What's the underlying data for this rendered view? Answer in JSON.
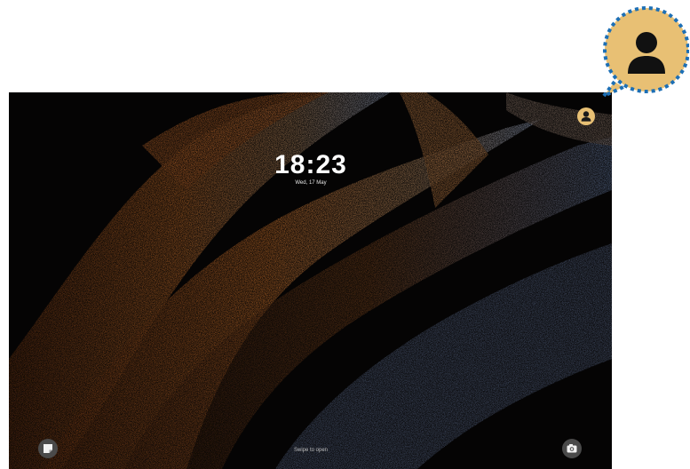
{
  "lock_screen": {
    "time": "18:23",
    "date": "Wed, 17 May",
    "swipe_hint": "Swipe to open"
  },
  "icons": {
    "user_profile": "person-icon",
    "left_shortcut": "note-icon",
    "right_shortcut": "camera-icon"
  },
  "colors": {
    "background": "#050404",
    "callout_fill": "#e8c074",
    "callout_border": "#1d6fb5",
    "wallpaper_warm": "#d87a2c",
    "wallpaper_cool": "#8aa6d4"
  }
}
